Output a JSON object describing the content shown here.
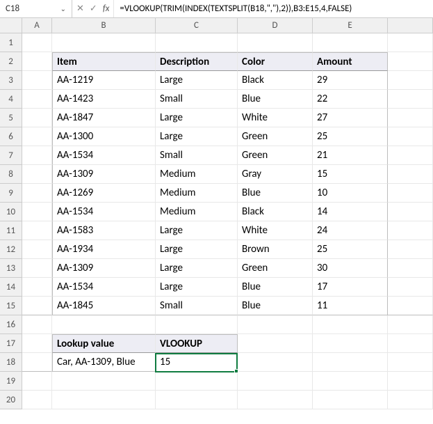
{
  "nameBox": "C18",
  "fxLabel": "fx",
  "formula": "=VLOOKUP(TRIM(INDEX(TEXTSPLIT(B18,\",\"),2)),B3:E15,4,FALSE)",
  "columns": [
    "A",
    "B",
    "C",
    "D",
    "E"
  ],
  "table": {
    "headers": {
      "item": "Item",
      "description": "Description",
      "color": "Color",
      "amount": "Amount"
    },
    "rows": [
      {
        "item": "AA-1219",
        "description": "Large",
        "color": "Black",
        "amount": "29"
      },
      {
        "item": "AA-1423",
        "description": "Small",
        "color": "Blue",
        "amount": "22"
      },
      {
        "item": "AA-1847",
        "description": "Large",
        "color": "White",
        "amount": "27"
      },
      {
        "item": "AA-1300",
        "description": "Large",
        "color": "Green",
        "amount": "25"
      },
      {
        "item": "AA-1534",
        "description": "Small",
        "color": "Green",
        "amount": "21"
      },
      {
        "item": "AA-1309",
        "description": "Medium",
        "color": "Gray",
        "amount": "15"
      },
      {
        "item": "AA-1269",
        "description": "Medium",
        "color": "Blue",
        "amount": "10"
      },
      {
        "item": "AA-1534",
        "description": "Medium",
        "color": "Black",
        "amount": "14"
      },
      {
        "item": "AA-1583",
        "description": "Large",
        "color": "White",
        "amount": "24"
      },
      {
        "item": "AA-1934",
        "description": "Large",
        "color": "Brown",
        "amount": "25"
      },
      {
        "item": "AA-1309",
        "description": "Large",
        "color": "Green",
        "amount": "30"
      },
      {
        "item": "AA-1534",
        "description": "Large",
        "color": "Blue",
        "amount": "17"
      },
      {
        "item": "AA-1845",
        "description": "Small",
        "color": "Blue",
        "amount": "11"
      }
    ]
  },
  "lookup": {
    "labelHeader": "Lookup value",
    "resultHeader": "VLOOKUP",
    "value": "Car, AA-1309, Blue",
    "result": "15"
  },
  "rowLabels": [
    "1",
    "2",
    "3",
    "4",
    "5",
    "6",
    "7",
    "8",
    "9",
    "10",
    "11",
    "12",
    "13",
    "14",
    "15",
    "16",
    "17",
    "18",
    "19",
    "20"
  ]
}
